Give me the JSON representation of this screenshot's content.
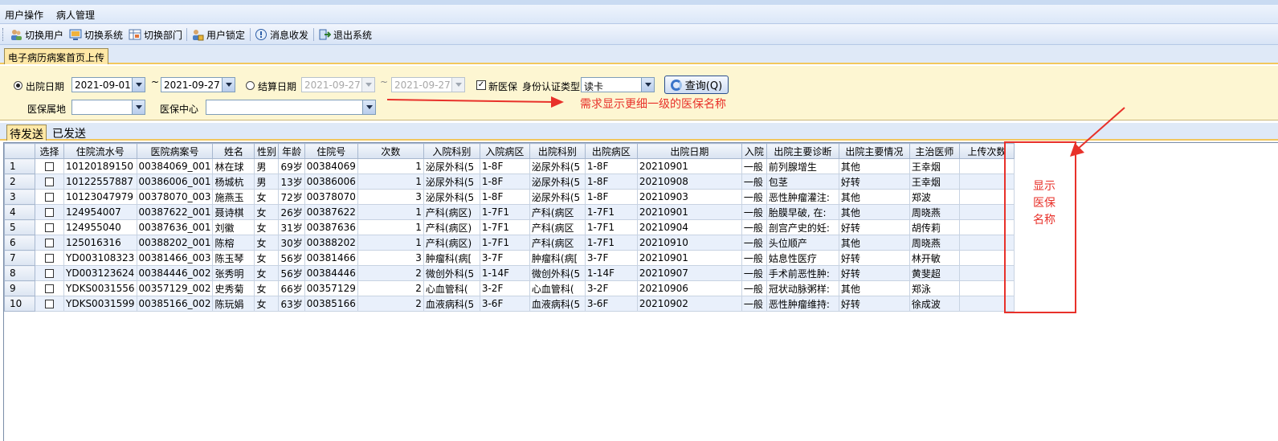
{
  "menubar": {
    "items": [
      "用户操作",
      "病人管理"
    ]
  },
  "toolbar": {
    "buttons": [
      {
        "label": "切换用户",
        "icon": "users-icon"
      },
      {
        "label": "切换系统",
        "icon": "system-icon"
      },
      {
        "label": "切换部门",
        "icon": "department-icon"
      },
      {
        "label": "用户锁定",
        "icon": "lock-user-icon"
      },
      {
        "label": "消息收发",
        "icon": "message-icon"
      },
      {
        "label": "退出系统",
        "icon": "exit-icon"
      }
    ]
  },
  "document_tab": {
    "label": "电子病历病案首页上传"
  },
  "filter": {
    "discharge_date_label": "出院日期",
    "discharge_from": "2021-09-01",
    "tilde1": "~",
    "discharge_to": "2021-09-27",
    "settle_date_label": "结算日期",
    "settle_from": "2021-09-27",
    "tilde2": "~",
    "settle_to": "2021-09-27",
    "new_insurance_label": "新医保",
    "id_type_label": "身份认证类型",
    "id_type_value": "读卡",
    "query_label": "查询(Q)",
    "insurance_region_label": "医保属地",
    "insurance_region_value": "",
    "insurance_center_label": "医保中心",
    "insurance_center_value": ""
  },
  "annotations": {
    "note1": "需求显示更细一级的医保名称",
    "box_lines": [
      "显示",
      "医保",
      "名称"
    ],
    "color": "#e8312a"
  },
  "subtabs": [
    "待发送",
    "已发送"
  ],
  "grid": {
    "columns": [
      "选择",
      "住院流水号",
      "医院病案号",
      "姓名",
      "性别",
      "年龄",
      "住院号",
      "次数",
      "入院科别",
      "入院病区",
      "出院科别",
      "出院病区",
      "出院日期",
      "入院",
      "出院主要诊断",
      "出院主要情况",
      "主治医师",
      "上传次数"
    ],
    "rows": [
      [
        "1",
        "10120189150",
        "00384069_001",
        "林在球",
        "男",
        "69岁",
        "00384069",
        "1",
        "泌尿外科(5",
        "1-8F",
        "泌尿外科(5",
        "1-8F",
        "20210901",
        "一般",
        "前列腺增生",
        "其他",
        "王幸烟",
        ""
      ],
      [
        "2",
        "10122557887",
        "00386006_001",
        "杨城杭",
        "男",
        "13岁",
        "00386006",
        "1",
        "泌尿外科(5",
        "1-8F",
        "泌尿外科(5",
        "1-8F",
        "20210908",
        "一般",
        "包茎",
        "好转",
        "王幸烟",
        ""
      ],
      [
        "3",
        "10123047979",
        "00378070_003",
        "施燕玉",
        "女",
        "72岁",
        "00378070",
        "3",
        "泌尿外科(5",
        "1-8F",
        "泌尿外科(5",
        "1-8F",
        "20210903",
        "一般",
        "恶性肿瘤灌注:",
        "其他",
        "郑波",
        ""
      ],
      [
        "4",
        "124954007",
        "00387622_001",
        "聂诗棋",
        "女",
        "26岁",
        "00387622",
        "1",
        "产科(病区)",
        "1-7F1",
        "产科(病区",
        "1-7F1",
        "20210901",
        "一般",
        "胎膜早破, 在:",
        "其他",
        "周晓燕",
        ""
      ],
      [
        "5",
        "124955040",
        "00387636_001",
        "刘徽",
        "女",
        "31岁",
        "00387636",
        "1",
        "产科(病区)",
        "1-7F1",
        "产科(病区",
        "1-7F1",
        "20210904",
        "一般",
        "剖宫产史的妊:",
        "好转",
        "胡传莉",
        ""
      ],
      [
        "6",
        "125016316",
        "00388202_001",
        "陈榕",
        "女",
        "30岁",
        "00388202",
        "1",
        "产科(病区)",
        "1-7F1",
        "产科(病区",
        "1-7F1",
        "20210910",
        "一般",
        "头位顺产",
        "其他",
        "周晓燕",
        ""
      ],
      [
        "7",
        "YD003108323",
        "00381466_003",
        "陈玉琴",
        "女",
        "56岁",
        "00381466",
        "3",
        "肿瘤科(病[",
        "3-7F",
        "肿瘤科(病[",
        "3-7F",
        "20210901",
        "一般",
        "姑息性医疗",
        "好转",
        "林开敏",
        ""
      ],
      [
        "8",
        "YD003123624",
        "00384446_002",
        "张秀明",
        "女",
        "56岁",
        "00384446",
        "2",
        "微创外科(5",
        "1-14F",
        "微创外科(5",
        "1-14F",
        "20210907",
        "一般",
        "手术前恶性肿:",
        "好转",
        "黄斐超",
        ""
      ],
      [
        "9",
        "YDKS0031556",
        "00357129_002",
        "史秀菊",
        "女",
        "66岁",
        "00357129",
        "2",
        "心血管科(",
        "3-2F",
        "心血管科(",
        "3-2F",
        "20210906",
        "一般",
        "冠状动脉粥样:",
        "其他",
        "郑泳",
        ""
      ],
      [
        "10",
        "YDKS0031599",
        "00385166_002",
        "陈玩娟",
        "女",
        "63岁",
        "00385166",
        "2",
        "血液病科(5",
        "3-6F",
        "血液病科(5",
        "3-6F",
        "20210902",
        "一般",
        "恶性肿瘤维持:",
        "好转",
        "徐成波",
        ""
      ]
    ]
  }
}
